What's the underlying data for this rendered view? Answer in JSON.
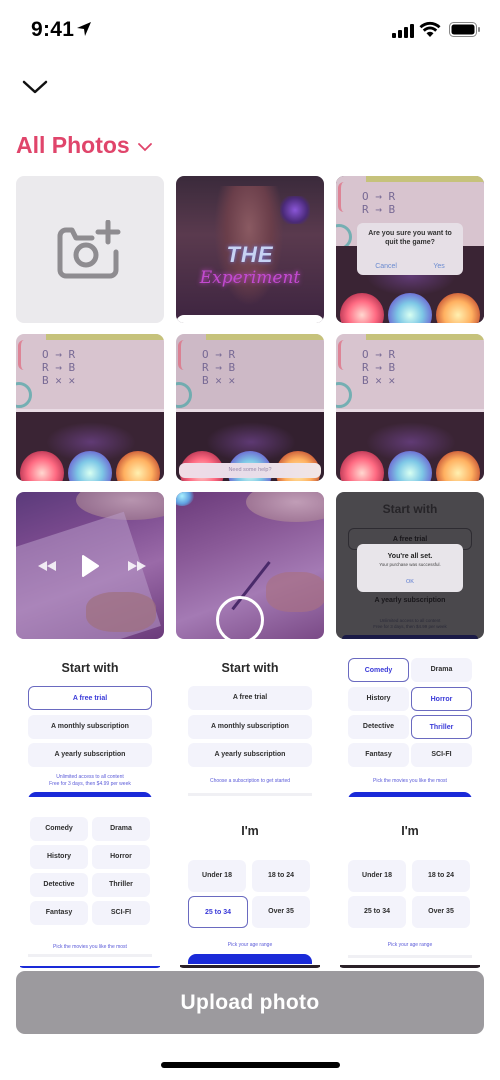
{
  "status_bar": {
    "time": "9:41",
    "icons": [
      "location-arrow-icon",
      "cellular-signal-icon",
      "wifi-icon",
      "battery-icon"
    ]
  },
  "header": {
    "collapse_icon": "chevron-down-icon",
    "album_title": "All Photos",
    "album_chevron_icon": "chevron-down-icon",
    "accent_color": "#e0456b"
  },
  "grid": {
    "camera_tile_icon": "camera-plus-icon",
    "photos": [
      {
        "kind": "poster",
        "title_line1": "THE",
        "title_line2": "Experiment"
      },
      {
        "kind": "game-alert",
        "alert_text": "Are you sure you want to quit the game?",
        "cancel": "Cancel",
        "confirm": "Yes",
        "board_lines": [
          "O → R",
          "R → B",
          "B ✕ ✕"
        ]
      },
      {
        "kind": "game-board",
        "board_lines": [
          "O → R",
          "R → B",
          "B ✕ ✕"
        ]
      },
      {
        "kind": "game-help",
        "board_lines": [
          "O → R",
          "R → B",
          "B ✕ ✕"
        ],
        "help_text": "Need some help?"
      },
      {
        "kind": "game-board",
        "board_lines": [
          "O → R",
          "R → B",
          "B ✕ ✕"
        ]
      },
      {
        "kind": "video",
        "controls": [
          "rewind-icon",
          "play-icon",
          "fast-forward-icon"
        ]
      },
      {
        "kind": "drawing"
      },
      {
        "kind": "purchase-alert",
        "heading": "Start with",
        "option_top": "A free trial",
        "option_bottom": "A yearly subscription",
        "alert_title": "You're all set.",
        "alert_subtitle": "Your purchase was successful.",
        "alert_button": "OK",
        "footer_line1": "Unlimited access to all content",
        "footer_line2": "Free for 3 days, then $4.99 per week"
      },
      {
        "kind": "start-with",
        "heading": "Start with",
        "options": [
          "A free trial",
          "A monthly subscription",
          "A yearly subscription"
        ],
        "selected": 0,
        "note_line1": "Unlimited access to all content",
        "note_line2": "Free for 3 days, then $4.99 per week"
      },
      {
        "kind": "start-with",
        "heading": "Start with",
        "options": [
          "A free trial",
          "A monthly subscription",
          "A yearly subscription"
        ],
        "selected": -1,
        "note_line1": "Choose a subscription to get started"
      },
      {
        "kind": "genres",
        "genres": [
          "Comedy",
          "Drama",
          "History",
          "Horror",
          "Detective",
          "Thriller",
          "Fantasy",
          "SCI-FI"
        ],
        "selected": [
          "Comedy",
          "Horror",
          "Thriller"
        ],
        "note": "Pick the movies you like the most"
      },
      {
        "kind": "genres",
        "genres": [
          "Comedy",
          "Drama",
          "History",
          "Horror",
          "Detective",
          "Thriller",
          "Fantasy",
          "SCI-FI"
        ],
        "selected": [],
        "note": "Pick the movies you like the most"
      },
      {
        "kind": "age",
        "heading": "I'm",
        "ages": [
          "Under 18",
          "18 to 24",
          "25 to 34",
          "Over 35"
        ],
        "selected": "25 to 34",
        "note": "Pick your age range"
      },
      {
        "kind": "age",
        "heading": "I'm",
        "ages": [
          "Under 18",
          "18 to 24",
          "25 to 34",
          "Over 35"
        ],
        "selected": null,
        "note": "Pick your age range"
      }
    ]
  },
  "upload_button": {
    "label": "Upload photo",
    "background": "#9c9a9e"
  }
}
